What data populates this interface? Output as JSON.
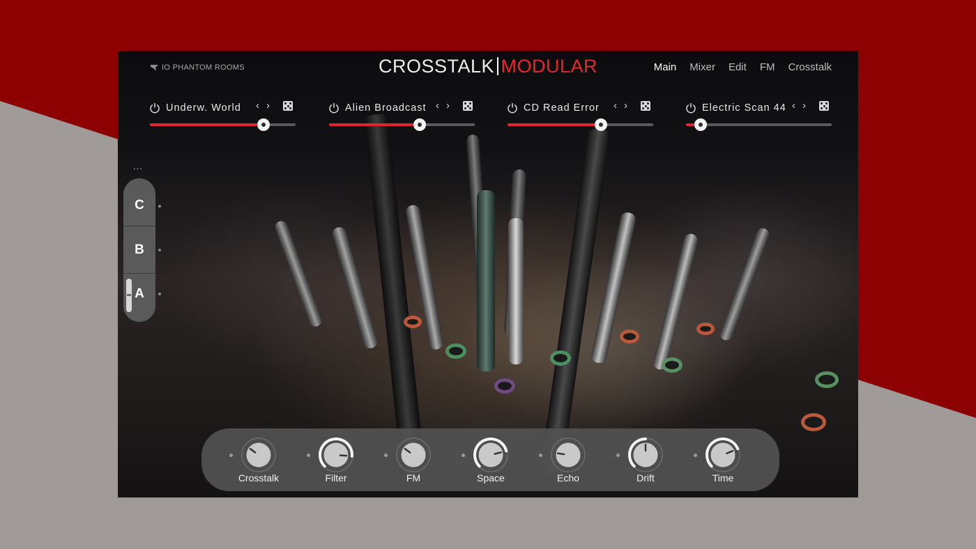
{
  "header": {
    "brand": "IO PHANTOM ROOMS",
    "title_left": "CROSSTALK",
    "title_right": "MODULAR",
    "nav": [
      {
        "label": "Main",
        "active": true
      },
      {
        "label": "Mixer",
        "active": false
      },
      {
        "label": "Edit",
        "active": false
      },
      {
        "label": "FM",
        "active": false
      },
      {
        "label": "Crosstalk",
        "active": false
      }
    ]
  },
  "slots": [
    {
      "name": "Underw. World",
      "value": 0.78
    },
    {
      "name": "Alien Broadcast",
      "value": 0.62
    },
    {
      "name": "CD Read Error",
      "value": 0.64
    },
    {
      "name": "Electric Scan 44",
      "value": 0.1
    }
  ],
  "slot_icons": {
    "power": "power-icon",
    "prev": "‹",
    "next": "›",
    "random": "dice-icon"
  },
  "scenes": {
    "more": "...",
    "items": [
      "C",
      "B",
      "A"
    ],
    "active": "A"
  },
  "knobs": [
    {
      "label": "Crosstalk",
      "value": 0.3
    },
    {
      "label": "Filter",
      "value": 0.85
    },
    {
      "label": "FM",
      "value": 0.3
    },
    {
      "label": "Space",
      "value": 0.78
    },
    {
      "label": "Echo",
      "value": 0.2
    },
    {
      "label": "Drift",
      "value": 0.5
    },
    {
      "label": "Time",
      "value": 0.75
    }
  ],
  "colors": {
    "accent_red": "#e0242a",
    "title_red": "#e8262b",
    "background_red": "#8e0102",
    "background_grey": "#a09b99"
  }
}
